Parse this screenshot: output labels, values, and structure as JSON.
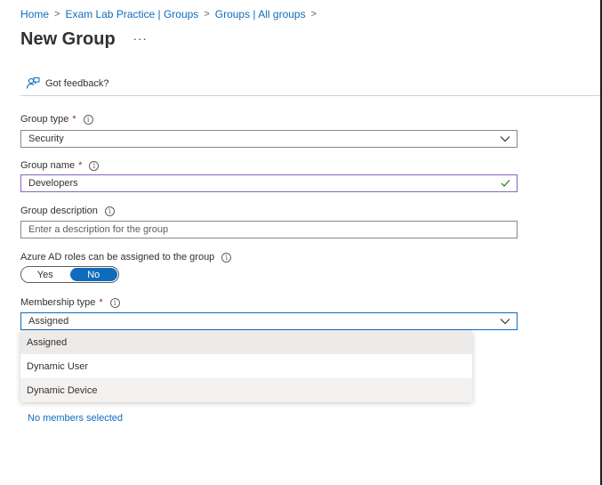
{
  "breadcrumb": {
    "items": [
      "Home",
      "Exam Lab Practice | Groups",
      "Groups | All groups"
    ],
    "separator": ">"
  },
  "page": {
    "title": "New Group",
    "more_label": "···"
  },
  "command_bar": {
    "feedback_label": "Got feedback?",
    "feedback_icon": "feedback-person-icon"
  },
  "form": {
    "group_type": {
      "label": "Group type",
      "required_marker": "*",
      "value": "Security"
    },
    "group_name": {
      "label": "Group name",
      "required_marker": "*",
      "value": "Developers"
    },
    "group_description": {
      "label": "Group description",
      "placeholder": "Enter a description for the group"
    },
    "azure_ad_roles": {
      "label": "Azure AD roles can be assigned to the group",
      "options": [
        "Yes",
        "No"
      ],
      "selected": "No"
    },
    "membership_type": {
      "label": "Membership type",
      "required_marker": "*",
      "value": "Assigned",
      "options": [
        "Assigned",
        "Dynamic User",
        "Dynamic Device"
      ]
    },
    "info_glyph": "i"
  },
  "members": {
    "link_text": "No members selected"
  },
  "colors": {
    "accent": "#0f6cbd",
    "required": "#a4262c",
    "valid_border": "#8764b8",
    "valid_check": "#107c10"
  }
}
